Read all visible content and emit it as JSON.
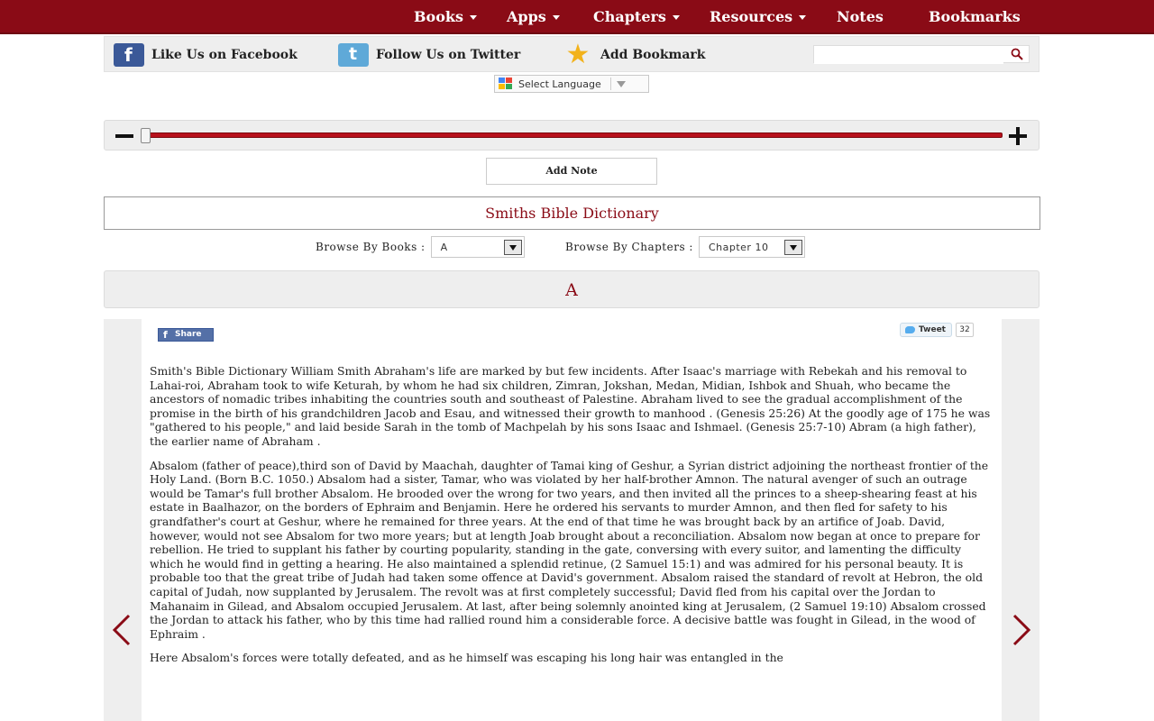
{
  "nav": {
    "items": [
      {
        "label": "Books",
        "dropdown": true
      },
      {
        "label": "Apps",
        "dropdown": true
      },
      {
        "label": "Chapters",
        "dropdown": true
      },
      {
        "label": "Resources",
        "dropdown": true
      },
      {
        "label": "Notes",
        "dropdown": false
      },
      {
        "label": "Bookmarks",
        "dropdown": false
      }
    ]
  },
  "social": {
    "facebook_label": "Like Us on Facebook",
    "twitter_label": "Follow Us on Twitter",
    "bookmark_label": "Add Bookmark",
    "search_value": ""
  },
  "language": {
    "label": "Select Language"
  },
  "zoom": {
    "level_fraction": 0.0
  },
  "add_note_label": "Add Note",
  "dictionary_title": "Smiths Bible Dictionary",
  "browse": {
    "books_label": "Browse By Books :",
    "books_value": "A",
    "chapters_label": "Browse By Chapters :",
    "chapters_value": "Chapter 10"
  },
  "letter_heading": "A",
  "share": {
    "share_label": "Share",
    "tweet_label": "Tweet",
    "tweet_count": "32"
  },
  "colors": {
    "brand": "#8a0b16",
    "accent_red": "#b8111c",
    "panel": "#eeeeee"
  },
  "entries": [
    "Smith's Bible Dictionary William Smith Abraham's life are marked by but few incidents. After Isaac's marriage with Rebekah and his removal to Lahai-roi, Abraham took to wife Keturah, by whom he had six children, Zimran, Jokshan, Medan, Midian, Ishbok and Shuah, who became the ancestors of nomadic tribes inhabiting the countries south and southeast of Palestine. Abraham lived to see the gradual accomplishment of the promise in the birth of his grandchildren Jacob and Esau, and witnessed their growth to manhood . (Genesis 25:26) At the goodly age of 175 he was \"gathered to his people,\" and laid beside Sarah in the tomb of Machpelah by his sons Isaac and Ishmael. (Genesis 25:7-10) Abram (a high father), the earlier name of Abraham .",
    "Absalom (father of peace),third son of David by Maachah, daughter of Tamai king of Geshur, a Syrian district adjoining the northeast frontier of the Holy Land. (Born B.C. 1050.) Absalom had a sister, Tamar, who was violated by her half-brother Amnon. The natural avenger of such an outrage would be Tamar's full brother Absalom. He brooded over the wrong for two years, and then invited all the princes to a sheep-shearing feast at his estate in Baalhazor, on the borders of Ephraim and Benjamin. Here he ordered his servants to murder Amnon, and then fled for safety to his grandfather's court at Geshur, where he remained for three years. At the end of that time he was brought back by an artifice of Joab. David, however, would not see Absalom for two more years; but at length Joab brought about a reconciliation. Absalom now began at once to prepare for rebellion. He tried to supplant his father by courting popularity, standing in the gate, conversing with every suitor, and lamenting the difficulty which he would find in getting a hearing. He also maintained a splendid retinue, (2 Samuel 15:1) and was admired for his personal beauty. It is probable too that the great tribe of Judah had taken some offence at David's government. Absalom raised the standard of revolt at Hebron, the old capital of Judah, now supplanted by Jerusalem. The revolt was at first completely successful; David fled from his capital over the Jordan to Mahanaim in Gilead, and Absalom occupied Jerusalem. At last, after being solemnly anointed king at Jerusalem, (2 Samuel 19:10) Absalom crossed the Jordan to attack his father, who by this time had rallied round him a considerable force. A decisive battle was fought in Gilead, in the wood of Ephraim .",
    "Here Absalom's forces were totally defeated, and as he himself was escaping his long hair was entangled in the"
  ]
}
